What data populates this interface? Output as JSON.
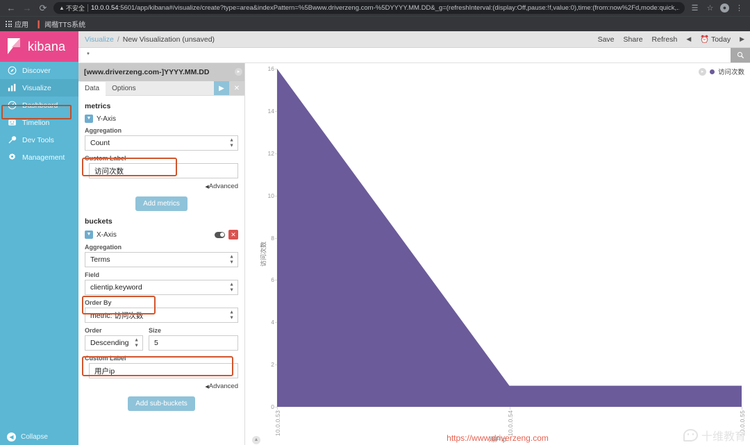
{
  "browser": {
    "back_icon": "back-arrow",
    "forward_icon": "forward-arrow",
    "reload_icon": "reload",
    "security_label": "不安全",
    "url_host": "10.0.0.54",
    "url_rest": ":5601/app/kibana#/visualize/create?type=area&indexPattern=%5Bwww.driverzeng.com-%5DYYYY.MM.DD&_g=(refreshInterval:(display:Off,pause:!f,value:0),time:(from:now%2Fd,mode:quick,...",
    "bookmarks": [
      {
        "label": "应用",
        "icon": "apps-grid-icon"
      },
      {
        "label": "闻楷TTS系统",
        "icon": "bookmark-favicon"
      }
    ]
  },
  "sidebar": {
    "brand": "kibana",
    "items": [
      {
        "label": "Discover",
        "icon": "compass-icon",
        "active": false
      },
      {
        "label": "Visualize",
        "icon": "bar-chart-icon",
        "active": true
      },
      {
        "label": "Dashboard",
        "icon": "dashboard-icon",
        "active": false
      },
      {
        "label": "Timelion",
        "icon": "timelion-icon",
        "active": false
      },
      {
        "label": "Dev Tools",
        "icon": "wrench-icon",
        "active": false
      },
      {
        "label": "Management",
        "icon": "gear-icon",
        "active": false
      }
    ],
    "collapse_label": "Collapse"
  },
  "topbar": {
    "breadcrumb_root": "Visualize",
    "breadcrumb_sep": "/",
    "breadcrumb_current": "New Visualization (unsaved)",
    "save_label": "Save",
    "share_label": "Share",
    "refresh_label": "Refresh",
    "prev_icon": "chevron-left-icon",
    "next_icon": "chevron-right-icon",
    "time_label": "Today",
    "clock_icon": "clock-icon"
  },
  "query": {
    "value": "*",
    "placeholder": "",
    "search_icon": "search-icon"
  },
  "config": {
    "index_pattern": "[www.driverzeng.com-]YYYY.MM.DD",
    "tabs": [
      {
        "label": "Data",
        "active": true
      },
      {
        "label": "Options",
        "active": false
      }
    ],
    "apply_icon": "play-icon",
    "cancel_icon": "close-icon",
    "metrics": {
      "section_title": "metrics",
      "agg_title": "Y-Axis",
      "aggregation_label": "Aggregation",
      "aggregation_value": "Count",
      "custom_label_label": "Custom Label",
      "custom_label_value": "访问次数",
      "advanced_label": "Advanced",
      "add_metrics_label": "Add metrics"
    },
    "buckets": {
      "section_title": "buckets",
      "agg_title": "X-Axis",
      "aggregation_label": "Aggregation",
      "aggregation_value": "Terms",
      "field_label": "Field",
      "field_value": "clientip.keyword",
      "order_by_label": "Order By",
      "order_by_value": "metric: 访问次数",
      "order_label": "Order",
      "order_value": "Descending",
      "size_label": "Size",
      "size_value": "5",
      "custom_label_label": "Custom Label",
      "custom_label_value": "用户ip",
      "advanced_label": "Advanced",
      "add_sub_buckets_label": "Add sub-buckets"
    },
    "highlight_color": "#d1552c"
  },
  "chart_data": {
    "type": "area",
    "title": "",
    "xlabel": "用户ip",
    "ylabel": "访问次数",
    "categories": [
      "10.0.0.53",
      "10.0.0.54",
      "10.0.0.55"
    ],
    "series": [
      {
        "name": "访问次数",
        "values": [
          16,
          1,
          1
        ],
        "color": "#6b5b9a"
      }
    ],
    "yticks": [
      0,
      2,
      4,
      6,
      8,
      10,
      12,
      14,
      16
    ],
    "ylim": [
      0,
      16
    ],
    "grid": false,
    "legend_position": "top-right",
    "legend_entries": [
      "访问次数"
    ]
  },
  "watermarks": {
    "url": "https://www.driverzeng.com",
    "brand": "十维教育",
    "brand_icon": "wechat-icon"
  }
}
